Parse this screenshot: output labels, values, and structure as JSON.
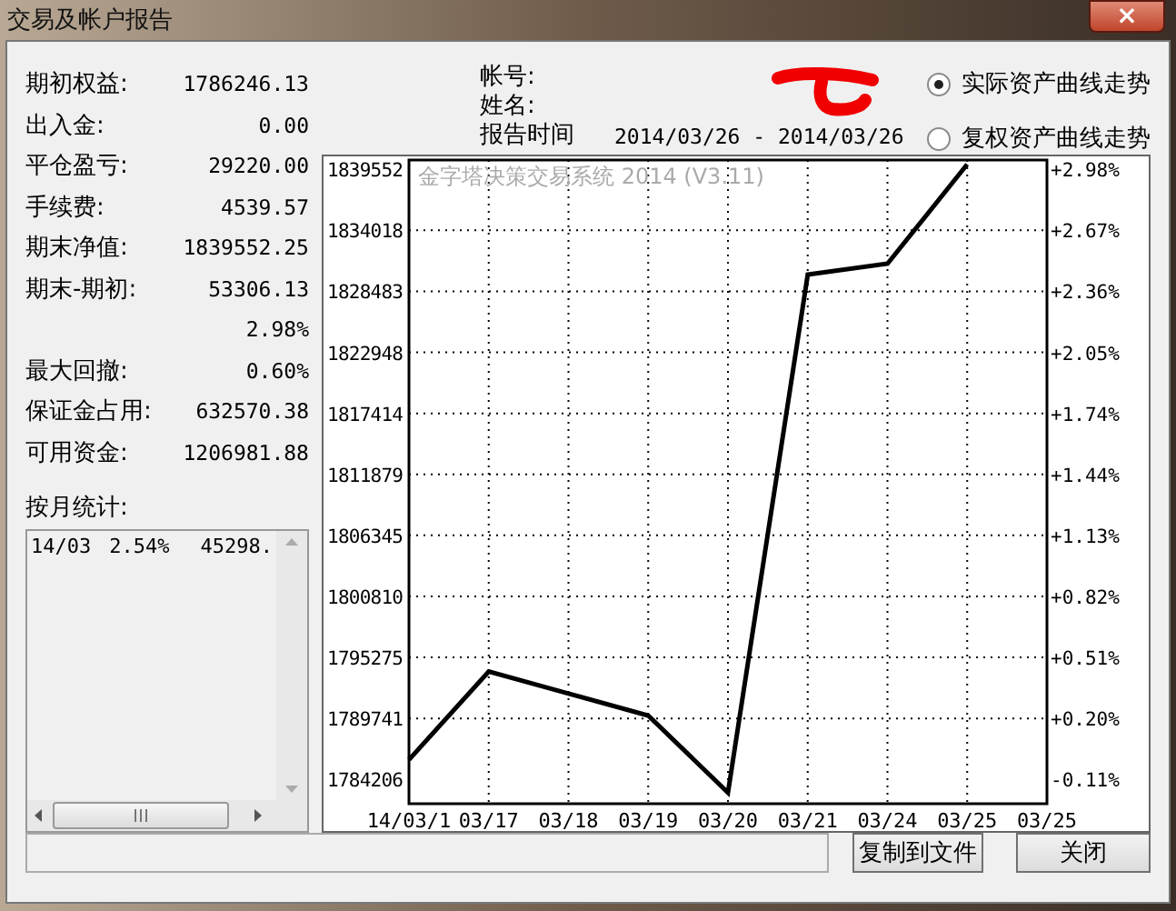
{
  "window": {
    "title": "交易及帐户报告",
    "close": "×"
  },
  "stats": [
    {
      "label": "期初权益:",
      "value": "1786246.13"
    },
    {
      "label": "出入金:",
      "value": "0.00"
    },
    {
      "label": "平仓盈亏:",
      "value": "29220.00"
    },
    {
      "label": "手续费:",
      "value": "4539.57"
    },
    {
      "label": "期末净值:",
      "value": "1839552.25"
    },
    {
      "label": "期末-期初:",
      "value": "53306.13"
    },
    {
      "value": "2.98%"
    },
    {
      "label": "最大回撤:",
      "value": "0.60%"
    },
    {
      "label": "保证金占用:",
      "value": "632570.38"
    },
    {
      "label": "可用资金:",
      "value": "1206981.88"
    }
  ],
  "monthly": {
    "label": "按月统计:",
    "rows": [
      {
        "month": "14/03",
        "percent": "2.54%",
        "amount": "45298."
      }
    ]
  },
  "header": {
    "account_label": "帐号:",
    "name_label": "姓名:",
    "report_time_label": "报告时间",
    "report_time": "2014/03/26 - 2014/03/26"
  },
  "curve_options": [
    {
      "label": "实际资产曲线走势",
      "selected": true
    },
    {
      "label": "复权资产曲线走势",
      "selected": false
    }
  ],
  "chart": {
    "right_axis_labels": [
      "+2.98%",
      "+2.67%",
      "+2.36%",
      "+2.05%",
      "+1.74%",
      "+1.44%",
      "+1.13%",
      "+0.82%",
      "+0.51%",
      "+0.20%",
      "-0.11%"
    ],
    "chart_data": {
      "type": "line",
      "title": "金字塔决策交易系统 2014 (V3.11)",
      "categories": [
        "14/03/1",
        "03/17",
        "03/18",
        "03/19",
        "03/20",
        "03/21",
        "03/24",
        "03/25",
        "03/25"
      ],
      "series": [
        {
          "color": "#000000",
          "values": [
            1786000,
            1794000,
            1792000,
            1790000,
            1783000,
            1830000,
            1831000,
            1840000,
            null
          ]
        }
      ],
      "ylim": [
        1782000,
        1840400
      ],
      "yticks": [
        1784206,
        1789741,
        1795275,
        1800810,
        1806345,
        1811879,
        1817414,
        1822948,
        1828483,
        1834018,
        1839552
      ],
      "grid": true
    }
  },
  "buttons": [
    {
      "label": "复制到文件"
    },
    {
      "label": "关闭"
    }
  ]
}
